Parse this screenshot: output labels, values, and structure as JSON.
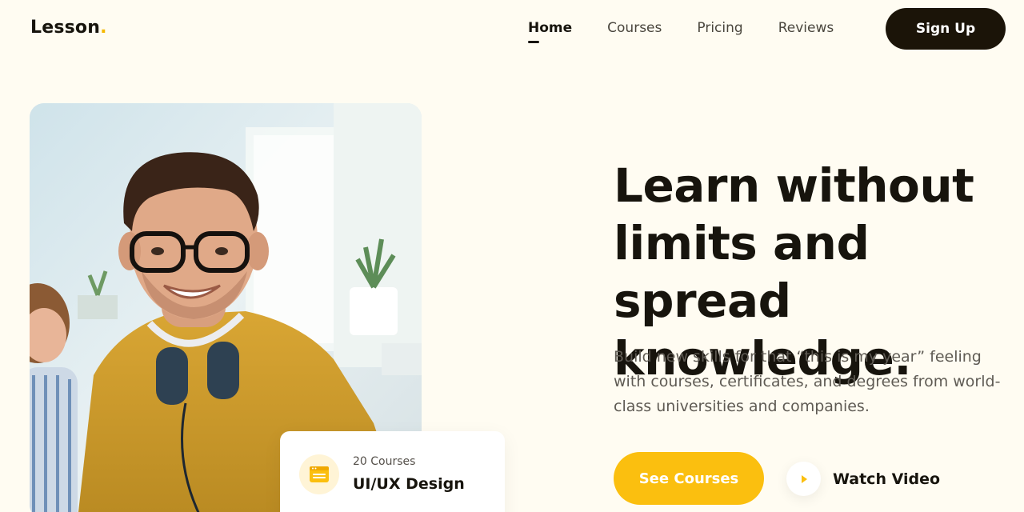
{
  "header": {
    "logo_text": "Lesson",
    "logo_dot": ".",
    "nav": [
      {
        "label": "Home",
        "active": true
      },
      {
        "label": "Courses",
        "active": false
      },
      {
        "label": "Pricing",
        "active": false
      },
      {
        "label": "Reviews",
        "active": false
      }
    ],
    "signup_label": "Sign Up"
  },
  "hero": {
    "headline": "Learn without limits and spread knowledge.",
    "subtext": "Build new skills for that “this is my year” feeling with courses, certificates, and degrees from world-class universities and companies.",
    "primary_button": "See Courses",
    "secondary_button": "Watch Video"
  },
  "course_card": {
    "icon": "browser-window-icon",
    "count": "20 Courses",
    "title": "UI/UX Design"
  },
  "colors": {
    "background": "#fffcf2",
    "accent": "#fbbf0f",
    "dark": "#1b1408"
  }
}
